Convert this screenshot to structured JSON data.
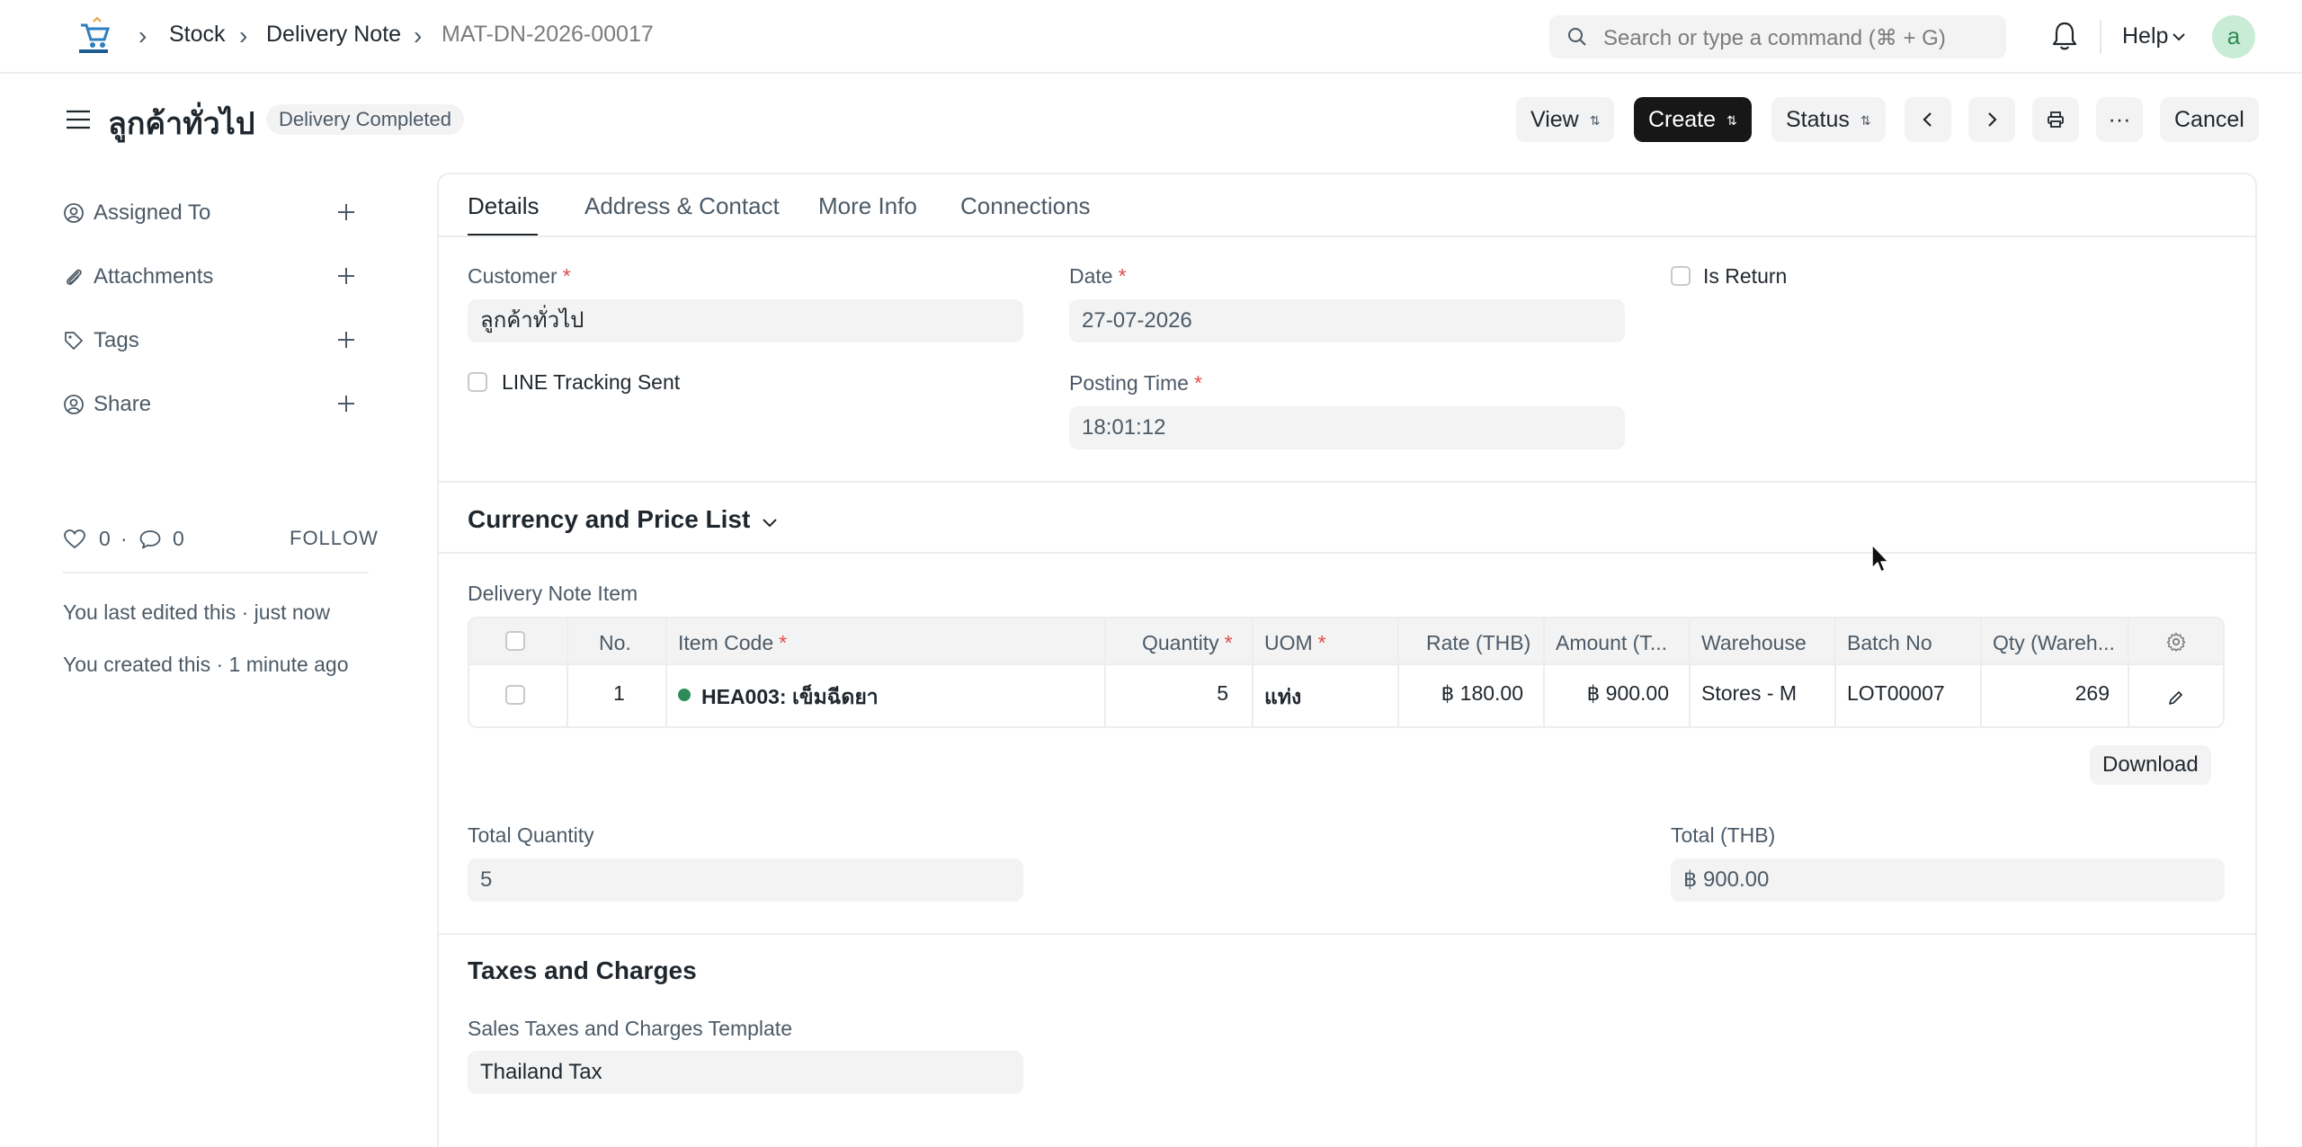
{
  "navbar": {
    "breadcrumbs": [
      "Stock",
      "Delivery Note",
      "MAT-DN-2026-00017"
    ],
    "search_placeholder": "Search or type a command (⌘ + G)",
    "help_label": "Help",
    "avatar_letter": "a"
  },
  "page": {
    "title": "ลูกค้าทั่วไป",
    "status": "Delivery Completed",
    "actions": {
      "view": "View",
      "create": "Create",
      "status": "Status",
      "more": "···",
      "cancel": "Cancel"
    }
  },
  "sidebar": {
    "items": [
      {
        "label": "Assigned To",
        "icon": "user-assign-icon"
      },
      {
        "label": "Attachments",
        "icon": "paperclip-icon"
      },
      {
        "label": "Tags",
        "icon": "tag-icon"
      },
      {
        "label": "Share",
        "icon": "share-icon"
      }
    ],
    "likes": "0",
    "comments": "0",
    "stats_sep": "·",
    "follow": "FOLLOW",
    "activity": [
      "You last edited this · just now",
      "You created this · 1 minute ago"
    ]
  },
  "tabs": [
    "Details",
    "Address & Contact",
    "More Info",
    "Connections"
  ],
  "form": {
    "customer_label": "Customer",
    "customer_value": "ลูกค้าทั่วไป",
    "date_label": "Date",
    "date_value": "27-07-2026",
    "is_return_label": "Is Return",
    "line_tracking_label": "LINE Tracking Sent",
    "posting_time_label": "Posting Time",
    "posting_time_value": "18:01:12",
    "currency_section": "Currency and Price List",
    "items_label": "Delivery Note Item",
    "table": {
      "headers": [
        "No.",
        "Item Code",
        "Quantity",
        "UOM",
        "Rate (THB)",
        "Amount (T...",
        "Warehouse",
        "Batch No",
        "Qty (Wareh..."
      ],
      "rows": [
        {
          "no": "1",
          "item_code": "HEA003: เข็มฉีดยา",
          "quantity": "5",
          "uom": "แท่ง",
          "rate": "฿ 180.00",
          "amount": "฿ 900.00",
          "warehouse": "Stores - M",
          "batch_no": "LOT00007",
          "qty_wareh": "269"
        }
      ]
    },
    "download_label": "Download",
    "total_qty_label": "Total Quantity",
    "total_qty_value": "5",
    "total_label": "Total (THB)",
    "total_value": "฿ 900.00",
    "taxes_section": "Taxes and Charges",
    "tax_template_label": "Sales Taxes and Charges Template",
    "tax_template_value": "Thailand Tax"
  },
  "colors": {
    "accent_dark": "#171717",
    "status_green": "#2e8b57",
    "required_red": "#e24c4c"
  }
}
